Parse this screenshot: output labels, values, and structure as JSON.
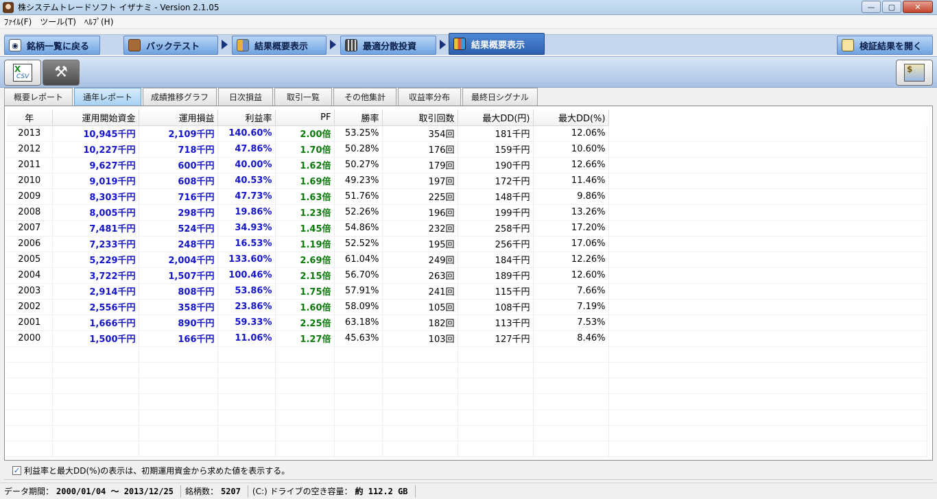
{
  "window": {
    "title": "株システムトレードソフト イザナミ - Version 2.1.05"
  },
  "menu": [
    {
      "label": "ﾌｧｲﾙ(F)"
    },
    {
      "label": "ツール(T)"
    },
    {
      "label": "ﾍﾙﾌﾟ(H)"
    }
  ],
  "nav": {
    "back": "銘柄一覧に戻る",
    "backtest": "バックテスト",
    "summary1": "結果概要表示",
    "optimize": "最適分散投資",
    "summary2": "結果概要表示",
    "open_results": "検証結果を開く"
  },
  "toolbar": {
    "csv_label": "CSV"
  },
  "subtabs": [
    {
      "label": "概要レポート"
    },
    {
      "label": "通年レポート"
    },
    {
      "label": "成績推移グラフ"
    },
    {
      "label": "日次損益"
    },
    {
      "label": "取引一覧"
    },
    {
      "label": "その他集計"
    },
    {
      "label": "収益率分布"
    },
    {
      "label": "最終日シグナル"
    }
  ],
  "table": {
    "headers": [
      "年",
      "運用開始資金",
      "運用損益",
      "利益率",
      "PF",
      "勝率",
      "取引回数",
      "最大DD(円)",
      "最大DD(%)"
    ],
    "rows": [
      [
        "2013",
        "10,945千円",
        "2,109千円",
        "140.60%",
        "2.00倍",
        "53.25%",
        "354回",
        "181千円",
        "12.06%"
      ],
      [
        "2012",
        "10,227千円",
        "718千円",
        "47.86%",
        "1.70倍",
        "50.28%",
        "176回",
        "159千円",
        "10.60%"
      ],
      [
        "2011",
        "9,627千円",
        "600千円",
        "40.00%",
        "1.62倍",
        "50.27%",
        "179回",
        "190千円",
        "12.66%"
      ],
      [
        "2010",
        "9,019千円",
        "608千円",
        "40.53%",
        "1.69倍",
        "49.23%",
        "197回",
        "172千円",
        "11.46%"
      ],
      [
        "2009",
        "8,303千円",
        "716千円",
        "47.73%",
        "1.63倍",
        "51.76%",
        "225回",
        "148千円",
        "9.86%"
      ],
      [
        "2008",
        "8,005千円",
        "298千円",
        "19.86%",
        "1.23倍",
        "52.26%",
        "196回",
        "199千円",
        "13.26%"
      ],
      [
        "2007",
        "7,481千円",
        "524千円",
        "34.93%",
        "1.45倍",
        "54.86%",
        "232回",
        "258千円",
        "17.20%"
      ],
      [
        "2006",
        "7,233千円",
        "248千円",
        "16.53%",
        "1.19倍",
        "52.52%",
        "195回",
        "256千円",
        "17.06%"
      ],
      [
        "2005",
        "5,229千円",
        "2,004千円",
        "133.60%",
        "2.69倍",
        "61.04%",
        "249回",
        "184千円",
        "12.26%"
      ],
      [
        "2004",
        "3,722千円",
        "1,507千円",
        "100.46%",
        "2.15倍",
        "56.70%",
        "263回",
        "189千円",
        "12.60%"
      ],
      [
        "2003",
        "2,914千円",
        "808千円",
        "53.86%",
        "1.75倍",
        "57.91%",
        "241回",
        "115千円",
        "7.66%"
      ],
      [
        "2002",
        "2,556千円",
        "358千円",
        "23.86%",
        "1.60倍",
        "58.09%",
        "105回",
        "108千円",
        "7.19%"
      ],
      [
        "2001",
        "1,666千円",
        "890千円",
        "59.33%",
        "2.25倍",
        "63.18%",
        "182回",
        "113千円",
        "7.53%"
      ],
      [
        "2000",
        "1,500千円",
        "166千円",
        "11.06%",
        "1.27倍",
        "45.63%",
        "103回",
        "127千円",
        "8.46%"
      ]
    ]
  },
  "note": {
    "checked": true,
    "text": "利益率と最大DD(%)の表示は、初期運用資金から求めた値を表示する。"
  },
  "status": {
    "period_label": "データ期間：",
    "period_value": "2000/01/04 〜 2013/12/25",
    "count_label": "銘柄数：",
    "count_value": "5207",
    "disk_label": "(C:) ドライブの空き容量：",
    "disk_value": "約 112.2 GB"
  },
  "colors": {
    "blue_value": "#1414c8",
    "green_value": "#0b7a0b",
    "active_tab": "#2c5fae"
  }
}
